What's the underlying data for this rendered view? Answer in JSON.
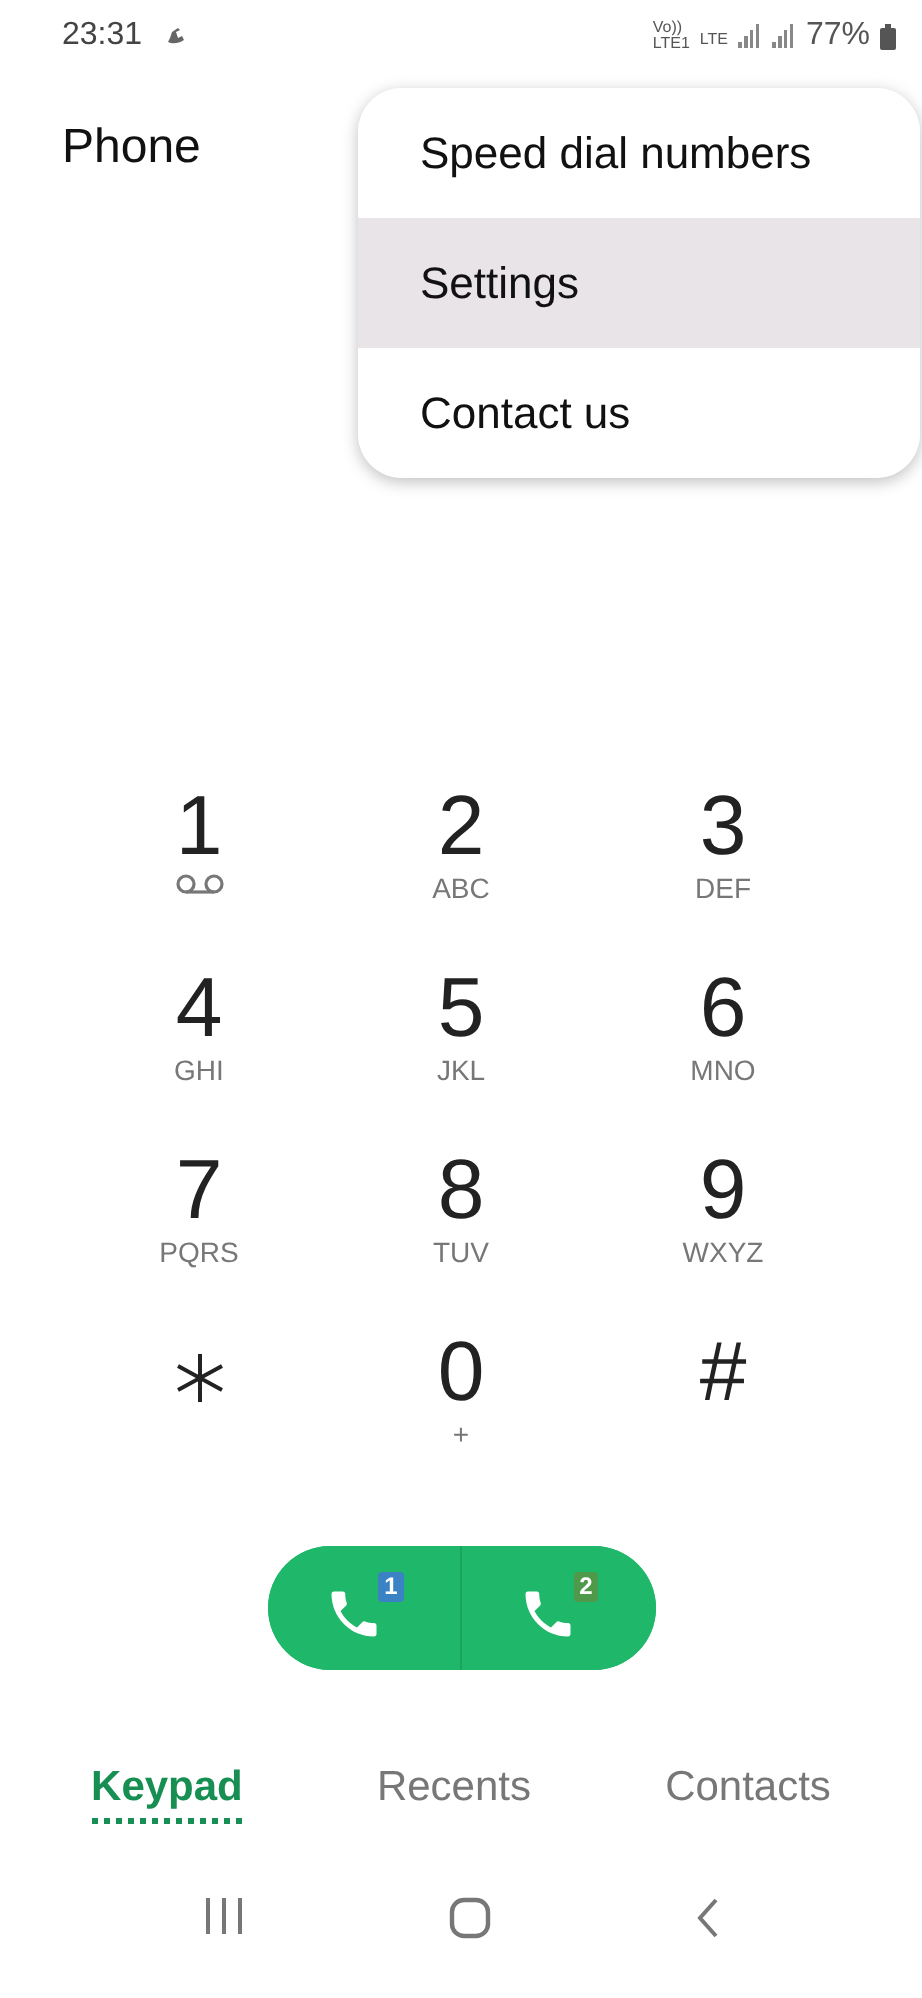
{
  "status_bar": {
    "time": "23:31",
    "network": [
      "Vo))",
      "LTE1",
      "LTE"
    ],
    "battery": "77%"
  },
  "title": "Phone",
  "menu": [
    {
      "label": "Speed dial numbers",
      "selected": false
    },
    {
      "label": "Settings",
      "selected": true
    },
    {
      "label": "Contact us",
      "selected": false
    }
  ],
  "keys": [
    {
      "kind": "voicemail",
      "digit": "1"
    },
    {
      "kind": "digit",
      "digit": "2",
      "sub": "ABC"
    },
    {
      "kind": "digit",
      "digit": "3",
      "sub": "DEF"
    },
    {
      "kind": "digit",
      "digit": "4",
      "sub": "GHI"
    },
    {
      "kind": "digit",
      "digit": "5",
      "sub": "JKL"
    },
    {
      "kind": "digit",
      "digit": "6",
      "sub": "MNO"
    },
    {
      "kind": "digit",
      "digit": "7",
      "sub": "PQRS"
    },
    {
      "kind": "digit",
      "digit": "8",
      "sub": "TUV"
    },
    {
      "kind": "digit",
      "digit": "9",
      "sub": "WXYZ"
    },
    {
      "kind": "star"
    },
    {
      "kind": "digit",
      "digit": "0",
      "sub": "+"
    },
    {
      "kind": "digit",
      "digit": "#"
    }
  ],
  "call_buttons": [
    {
      "sim": "1",
      "color": "#3b82c4"
    },
    {
      "sim": "2",
      "color": "#4f9a4a"
    }
  ],
  "tabs": [
    {
      "label": "Keypad",
      "selected": true
    },
    {
      "label": "Recents",
      "selected": false
    },
    {
      "label": "Contacts",
      "selected": false
    }
  ]
}
